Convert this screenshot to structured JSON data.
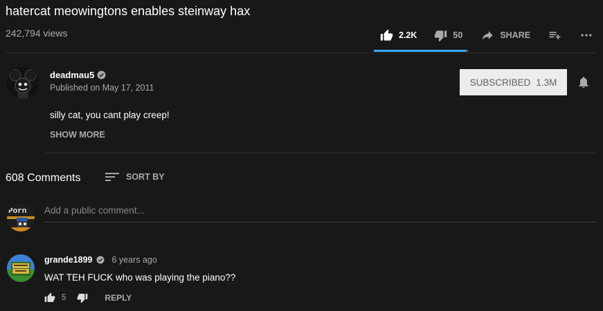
{
  "video": {
    "title": "hatercat meowingtons enables steinway hax",
    "views": "242,794 views",
    "likes": "2.2K",
    "dislikes": "50",
    "like_ratio": 0.978,
    "share_label": "SHARE",
    "save_icon": "playlist-add-icon",
    "more_icon": "more-horiz-icon"
  },
  "channel": {
    "name": "deadmau5",
    "verified_icon": "verified-check-icon",
    "published": "Published on May 17, 2011",
    "subscribe_label": "SUBSCRIBED",
    "subscriber_count": "1.3M",
    "bell_icon": "notification-bell-icon",
    "description": "silly cat, you cant play creep!",
    "show_more": "SHOW MORE"
  },
  "comments": {
    "count": "608 Comments",
    "sort_label": "SORT BY",
    "placeholder": "Add a public comment...",
    "items": [
      {
        "author": "grande1899",
        "time": "6 years ago",
        "text": "WAT TEH FUCK who was playing the piano??",
        "likes": "5",
        "reply_label": "REPLY"
      }
    ]
  },
  "colors": {
    "background": "#181818",
    "text": "#ffffff",
    "muted": "#aaaaaa",
    "accent": "#3ea6ff",
    "subscribed_bg": "#ececec"
  }
}
